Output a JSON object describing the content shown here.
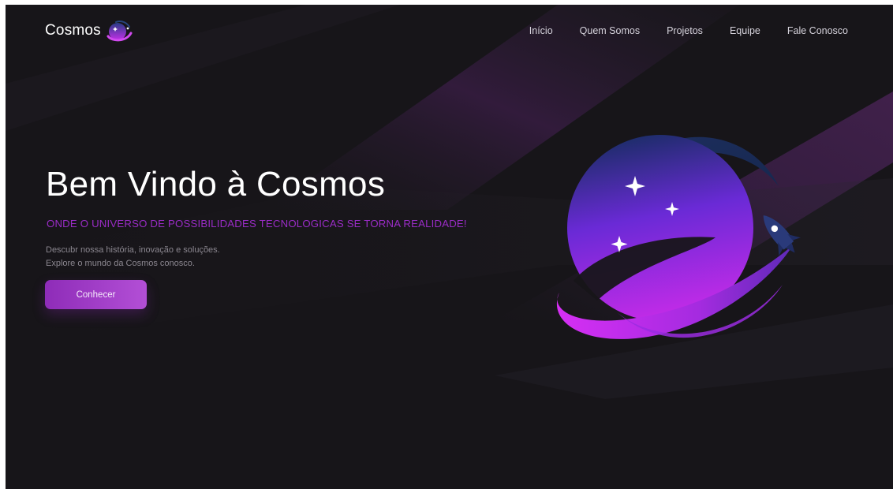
{
  "brand": {
    "name": "Cosmos",
    "logo_icon": "planet-logo-icon"
  },
  "nav": {
    "items": [
      {
        "label": "Início"
      },
      {
        "label": "Quem Somos"
      },
      {
        "label": "Projetos"
      },
      {
        "label": "Equipe"
      },
      {
        "label": "Fale Conosco"
      }
    ]
  },
  "hero": {
    "title": "Bem Vindo à Cosmos",
    "tagline": "ONDE O UNIVERSO DE POSSIBILIDADES TECNOLOGICAS SE TORNA REALIDADE!",
    "description_line1": "Descubr nossa história, inovação e soluções.",
    "description_line2": "Explore o mundo da Cosmos conosco.",
    "cta_label": "Conhecer",
    "illustration_icons": [
      "planet-icon",
      "orbit-ring-icon",
      "rocket-icon",
      "sparkle-star-icon"
    ]
  },
  "colors": {
    "background": "#171519",
    "accent_purple": "#9a2cc6",
    "button_gradient_start": "#8e2cb8",
    "button_gradient_end": "#b34fd6",
    "planet_gradient_top": "#1b2f66",
    "planet_gradient_bottom": "#d42bf0",
    "text_primary": "#ffffff",
    "text_muted": "#8b8790"
  }
}
